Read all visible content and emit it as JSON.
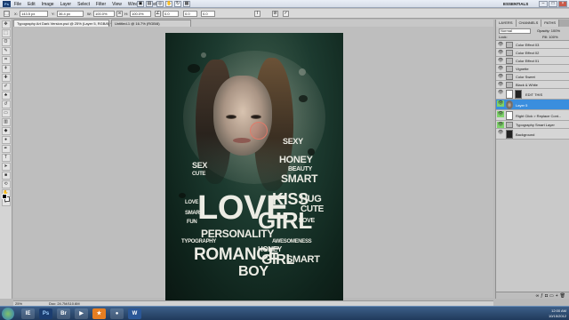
{
  "menubar": {
    "logo": "Ps",
    "menus": [
      "File",
      "Edit",
      "Image",
      "Layer",
      "Select",
      "Filter",
      "View",
      "Window",
      "Help"
    ],
    "workspace": "ESSENTIALS"
  },
  "options": {
    "w": "143.5 px",
    "h": "36.4 px",
    "w_pct": "100.0%",
    "h_pct": "100.0%",
    "angle": "0.0"
  },
  "tabs": [
    {
      "label": "Typography Art Dark Version.psd @ 25% (Layer 5, RGB/8) *",
      "active": true
    },
    {
      "label": "Untitled-1 @ 16.7% (RGB/8)",
      "active": false
    }
  ],
  "layers_panel": {
    "tabs": [
      "LAYERS",
      "CHANNELS",
      "PATHS"
    ],
    "blend_mode": "Normal",
    "opacity": "Opacity: 100%",
    "lock": "Lock:",
    "fill": "Fill: 100%",
    "layers": [
      {
        "name": "Color Effect 03"
      },
      {
        "name": "Color Effect 02"
      },
      {
        "name": "Color Effect 01"
      },
      {
        "name": "Vignette"
      },
      {
        "name": "Color Sweet"
      },
      {
        "name": "Black & White"
      },
      {
        "name": "EDIT THIS"
      },
      {
        "name": "Layer 5",
        "selected": true
      },
      {
        "name": "Right Click > Replace Cont..."
      },
      {
        "name": "Typography Smart Layer"
      },
      {
        "name": "Background"
      }
    ]
  },
  "artwork": {
    "words": [
      "SEXY",
      "HONEY",
      "BEAUTY",
      "SMART",
      "SEX",
      "CUTE",
      "LOVE",
      "KISS",
      "HUG",
      "CUTE",
      "GIRL",
      "PERSONALITY",
      "TYPOGRAPHY",
      "AWESOMENESS",
      "HONEY",
      "ROMANCE",
      "GIRL",
      "SMART",
      "BOY",
      "SMART",
      "FUN",
      "LOVE",
      "LOVE"
    ]
  },
  "statusbar": {
    "zoom": "25%",
    "doc": "Doc: 24.7M/110.6M"
  },
  "taskbar": {
    "apps": [
      "IE",
      "Ps",
      "Br",
      "▶",
      "★",
      "●",
      "W"
    ],
    "time": "12:00 AM",
    "date": "10/15/2012"
  }
}
